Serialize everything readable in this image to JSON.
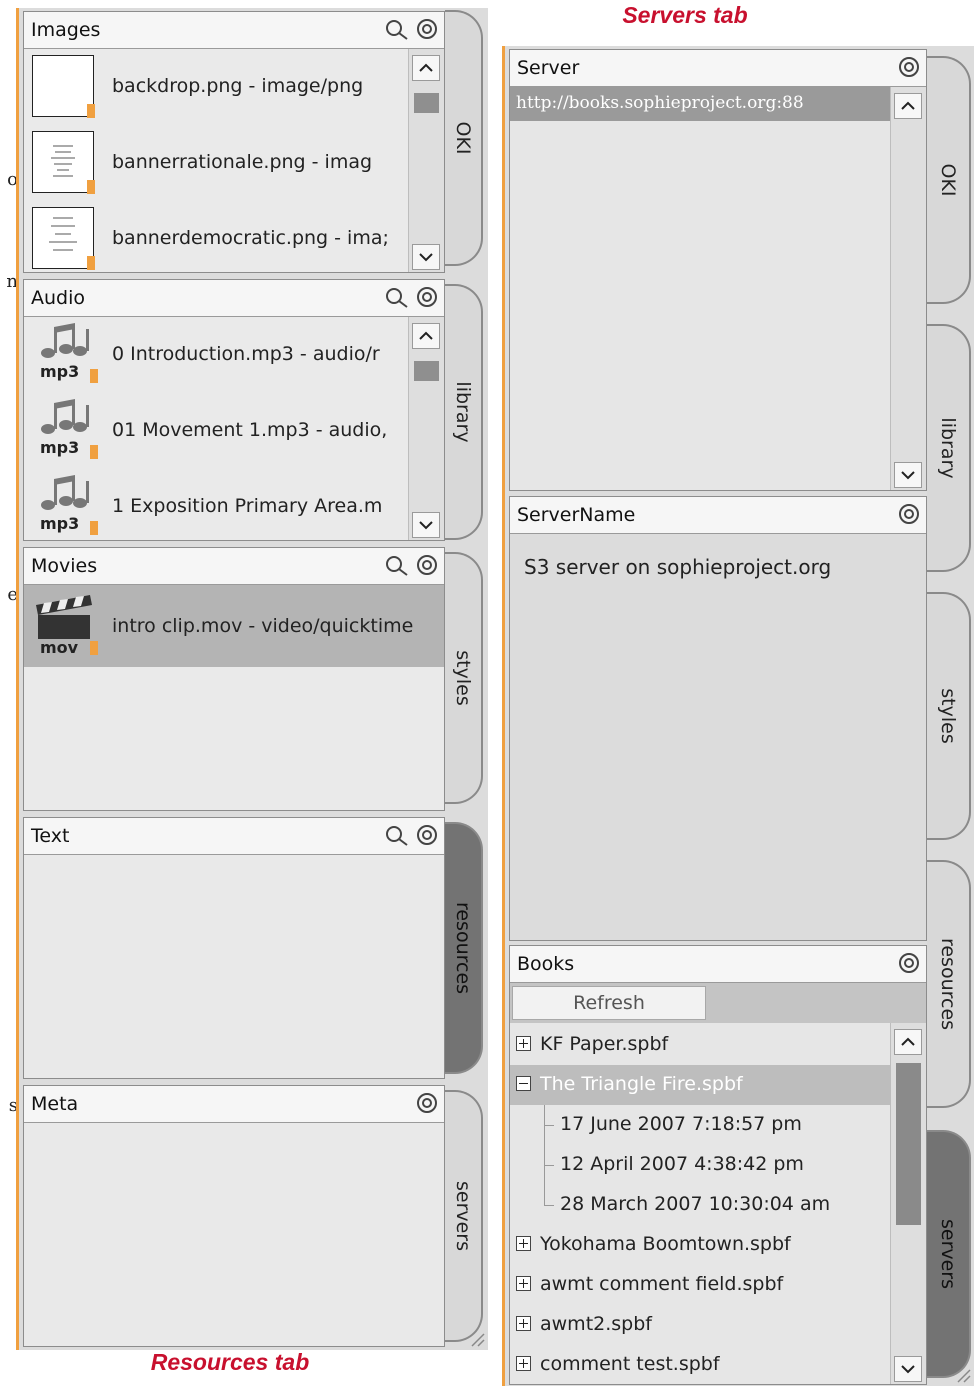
{
  "stray_left_chars": [
    "o",
    "n",
    "e",
    "s"
  ],
  "captions": {
    "servers": "Servers tab",
    "resources": "Resources tab"
  },
  "left": {
    "images": {
      "title": "Images",
      "items": [
        {
          "label": "backdrop.png - image/png",
          "thumb": "blank-image-thumb"
        },
        {
          "label": "bannerrationale.png - imag",
          "thumb": "banner-image-thumb"
        },
        {
          "label": "bannerdemocratic.png - ima;",
          "thumb": "banner-image-thumb"
        }
      ]
    },
    "audio": {
      "title": "Audio",
      "items": [
        {
          "label": "0 Introduction.mp3 - audio/r",
          "icon_text": "mp3"
        },
        {
          "label": "01 Movement 1.mp3 - audio,",
          "icon_text": "mp3"
        },
        {
          "label": "1 Exposition Primary Area.m",
          "icon_text": "mp3"
        }
      ]
    },
    "movies": {
      "title": "Movies",
      "items": [
        {
          "label": "intro clip.mov - video/quicktime",
          "icon_text": "mov"
        }
      ]
    },
    "text": {
      "title": "Text"
    },
    "meta": {
      "title": "Meta"
    },
    "tabs": [
      "OKI",
      "library",
      "styles",
      "resources",
      "servers"
    ],
    "active_tab": "resources"
  },
  "right": {
    "server": {
      "title": "Server",
      "url": "http://books.sophieproject.org:88"
    },
    "server_name": {
      "title": "ServerName",
      "value": "S3 server on sophieproject.org"
    },
    "books": {
      "title": "Books",
      "refresh_label": "Refresh",
      "items": [
        {
          "label": "KF Paper.spbf",
          "expanded": false
        },
        {
          "label": "The Triangle Fire.spbf",
          "expanded": true,
          "selected": true,
          "children": [
            "17 June 2007 7:18:57 pm",
            "12 April 2007 4:38:42 pm",
            "28 March 2007 10:30:04 am"
          ]
        },
        {
          "label": "Yokohama Boomtown.spbf",
          "expanded": false
        },
        {
          "label": "awmt comment field.spbf",
          "expanded": false
        },
        {
          "label": "awmt2.spbf",
          "expanded": false
        },
        {
          "label": "comment test.spbf",
          "expanded": false
        }
      ]
    },
    "tabs": [
      "OKI",
      "library",
      "styles",
      "resources",
      "servers"
    ],
    "active_tab": "servers"
  },
  "colors": {
    "accent_orange": "#f0a040",
    "caption_red": "#c8102e",
    "selection_gray": "#9a9a9a",
    "active_tab": "#737373"
  }
}
